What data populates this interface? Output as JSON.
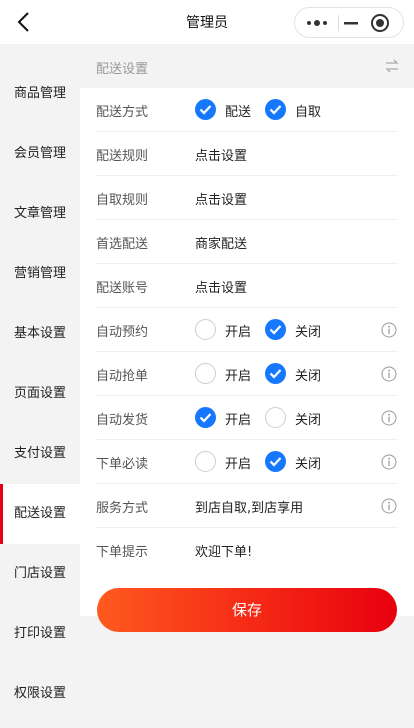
{
  "header": {
    "title": "管理员"
  },
  "sidebar": {
    "items": [
      {
        "label": "商品管理",
        "active": false
      },
      {
        "label": "会员管理",
        "active": false
      },
      {
        "label": "文章管理",
        "active": false
      },
      {
        "label": "营销管理",
        "active": false
      },
      {
        "label": "基本设置",
        "active": false
      },
      {
        "label": "页面设置",
        "active": false
      },
      {
        "label": "支付设置",
        "active": false
      },
      {
        "label": "配送设置",
        "active": true
      },
      {
        "label": "门店设置",
        "active": false
      },
      {
        "label": "打印设置",
        "active": false
      },
      {
        "label": "权限设置",
        "active": false
      }
    ]
  },
  "section": {
    "title": "配送设置"
  },
  "form": {
    "delivery_method": {
      "label": "配送方式",
      "options": [
        {
          "label": "配送",
          "checked": true
        },
        {
          "label": "自取",
          "checked": true
        }
      ]
    },
    "delivery_rules": {
      "label": "配送规则",
      "value": "点击设置"
    },
    "pickup_rules": {
      "label": "自取规则",
      "value": "点击设置"
    },
    "preferred_delivery": {
      "label": "首选配送",
      "value": "商家配送"
    },
    "delivery_account": {
      "label": "配送账号",
      "value": "点击设置"
    },
    "auto_reserve": {
      "label": "自动预约",
      "on_label": "开启",
      "off_label": "关闭",
      "state": "off"
    },
    "auto_grab": {
      "label": "自动抢单",
      "on_label": "开启",
      "off_label": "关闭",
      "state": "off"
    },
    "auto_ship": {
      "label": "自动发货",
      "on_label": "开启",
      "off_label": "关闭",
      "state": "on"
    },
    "must_read": {
      "label": "下单必读",
      "on_label": "开启",
      "off_label": "关闭",
      "state": "off"
    },
    "service_mode": {
      "label": "服务方式",
      "value": "到店自取,到店享用"
    },
    "order_tip": {
      "label": "下单提示",
      "value": "欢迎下单!"
    }
  },
  "actions": {
    "save_label": "保存"
  },
  "colors": {
    "accent": "#1677ff",
    "active_bar": "#e60012",
    "save_gradient_start": "#ff5a1f",
    "save_gradient_end": "#e8000e"
  }
}
